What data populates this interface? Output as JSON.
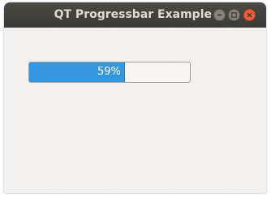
{
  "window": {
    "title": "QT Progressbar Example",
    "controls": {
      "minimize_icon": "minimize-icon",
      "maximize_icon": "maximize-icon",
      "close_icon": "close-icon"
    }
  },
  "progress_bar": {
    "value": 59,
    "max": 100,
    "label": "59%",
    "fill_color": "#3596e0"
  },
  "colors": {
    "titlebar": "#3c3b37",
    "window_bg": "#f2f1f0",
    "close_button": "#e8603c"
  }
}
